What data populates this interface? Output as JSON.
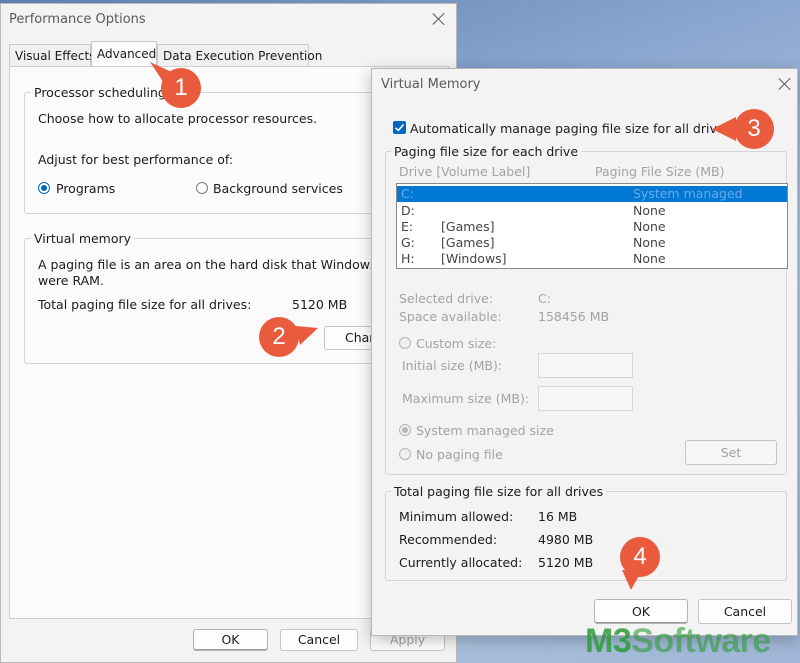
{
  "performance_options": {
    "title": "Performance Options",
    "tabs": [
      {
        "label": "Visual Effects"
      },
      {
        "label": "Advanced"
      },
      {
        "label": "Data Execution Prevention"
      }
    ],
    "processor_scheduling": {
      "title": "Processor scheduling",
      "description": "Choose how to allocate processor resources.",
      "adjust_label": "Adjust for best performance of:",
      "option_programs": "Programs",
      "option_background": "Background services",
      "selected": "Programs"
    },
    "virtual_memory": {
      "title": "Virtual memory",
      "desc_line1": "A paging file is an area on the hard disk that Windows use",
      "desc_line2": "were RAM.",
      "total_label": "Total paging file size for all drives:",
      "total_value": "5120 MB",
      "change_button": "Char"
    },
    "buttons": {
      "ok": "OK",
      "cancel": "Cancel",
      "apply": "Apply"
    }
  },
  "virtual_memory_dialog": {
    "title": "Virtual Memory",
    "auto_manage_label": "Automatically manage paging file size for all drives",
    "auto_manage_checked": true,
    "each_drive_title": "Paging file size for each drive",
    "col_drive": "Drive  [Volume Label]",
    "col_size": "Paging File Size (MB)",
    "drives": [
      {
        "drive": "C:",
        "label": "",
        "size": "System managed",
        "selected": true
      },
      {
        "drive": "D:",
        "label": "",
        "size": "None",
        "selected": false
      },
      {
        "drive": "E:",
        "label": "[Games]",
        "size": "None",
        "selected": false
      },
      {
        "drive": "G:",
        "label": "[Games]",
        "size": "None",
        "selected": false
      },
      {
        "drive": "H:",
        "label": "[Windows]",
        "size": "None",
        "selected": false
      }
    ],
    "selected_drive_label": "Selected drive:",
    "selected_drive_value": "C:",
    "space_available_label": "Space available:",
    "space_available_value": "158456 MB",
    "custom_size": "Custom size:",
    "initial_size": "Initial size (MB):",
    "maximum_size": "Maximum size (MB):",
    "system_managed": "System managed size",
    "no_paging": "No paging file",
    "set_button": "Set",
    "totals": {
      "title": "Total paging file size for all drives",
      "minimum_label": "Minimum allowed:",
      "minimum_value": "16 MB",
      "recommended_label": "Recommended:",
      "recommended_value": "4980 MB",
      "allocated_label": "Currently allocated:",
      "allocated_value": "5120 MB"
    },
    "ok_button": "OK",
    "cancel_button": "Cancel"
  },
  "callouts": [
    "1",
    "2",
    "3",
    "4"
  ],
  "watermark": {
    "part1": "M3",
    "part2": "Software"
  },
  "colors": {
    "accent": "#0067c0",
    "selection": "#0078d4",
    "callout": "#ea5a3d",
    "watermark": "#2e9c3c"
  }
}
